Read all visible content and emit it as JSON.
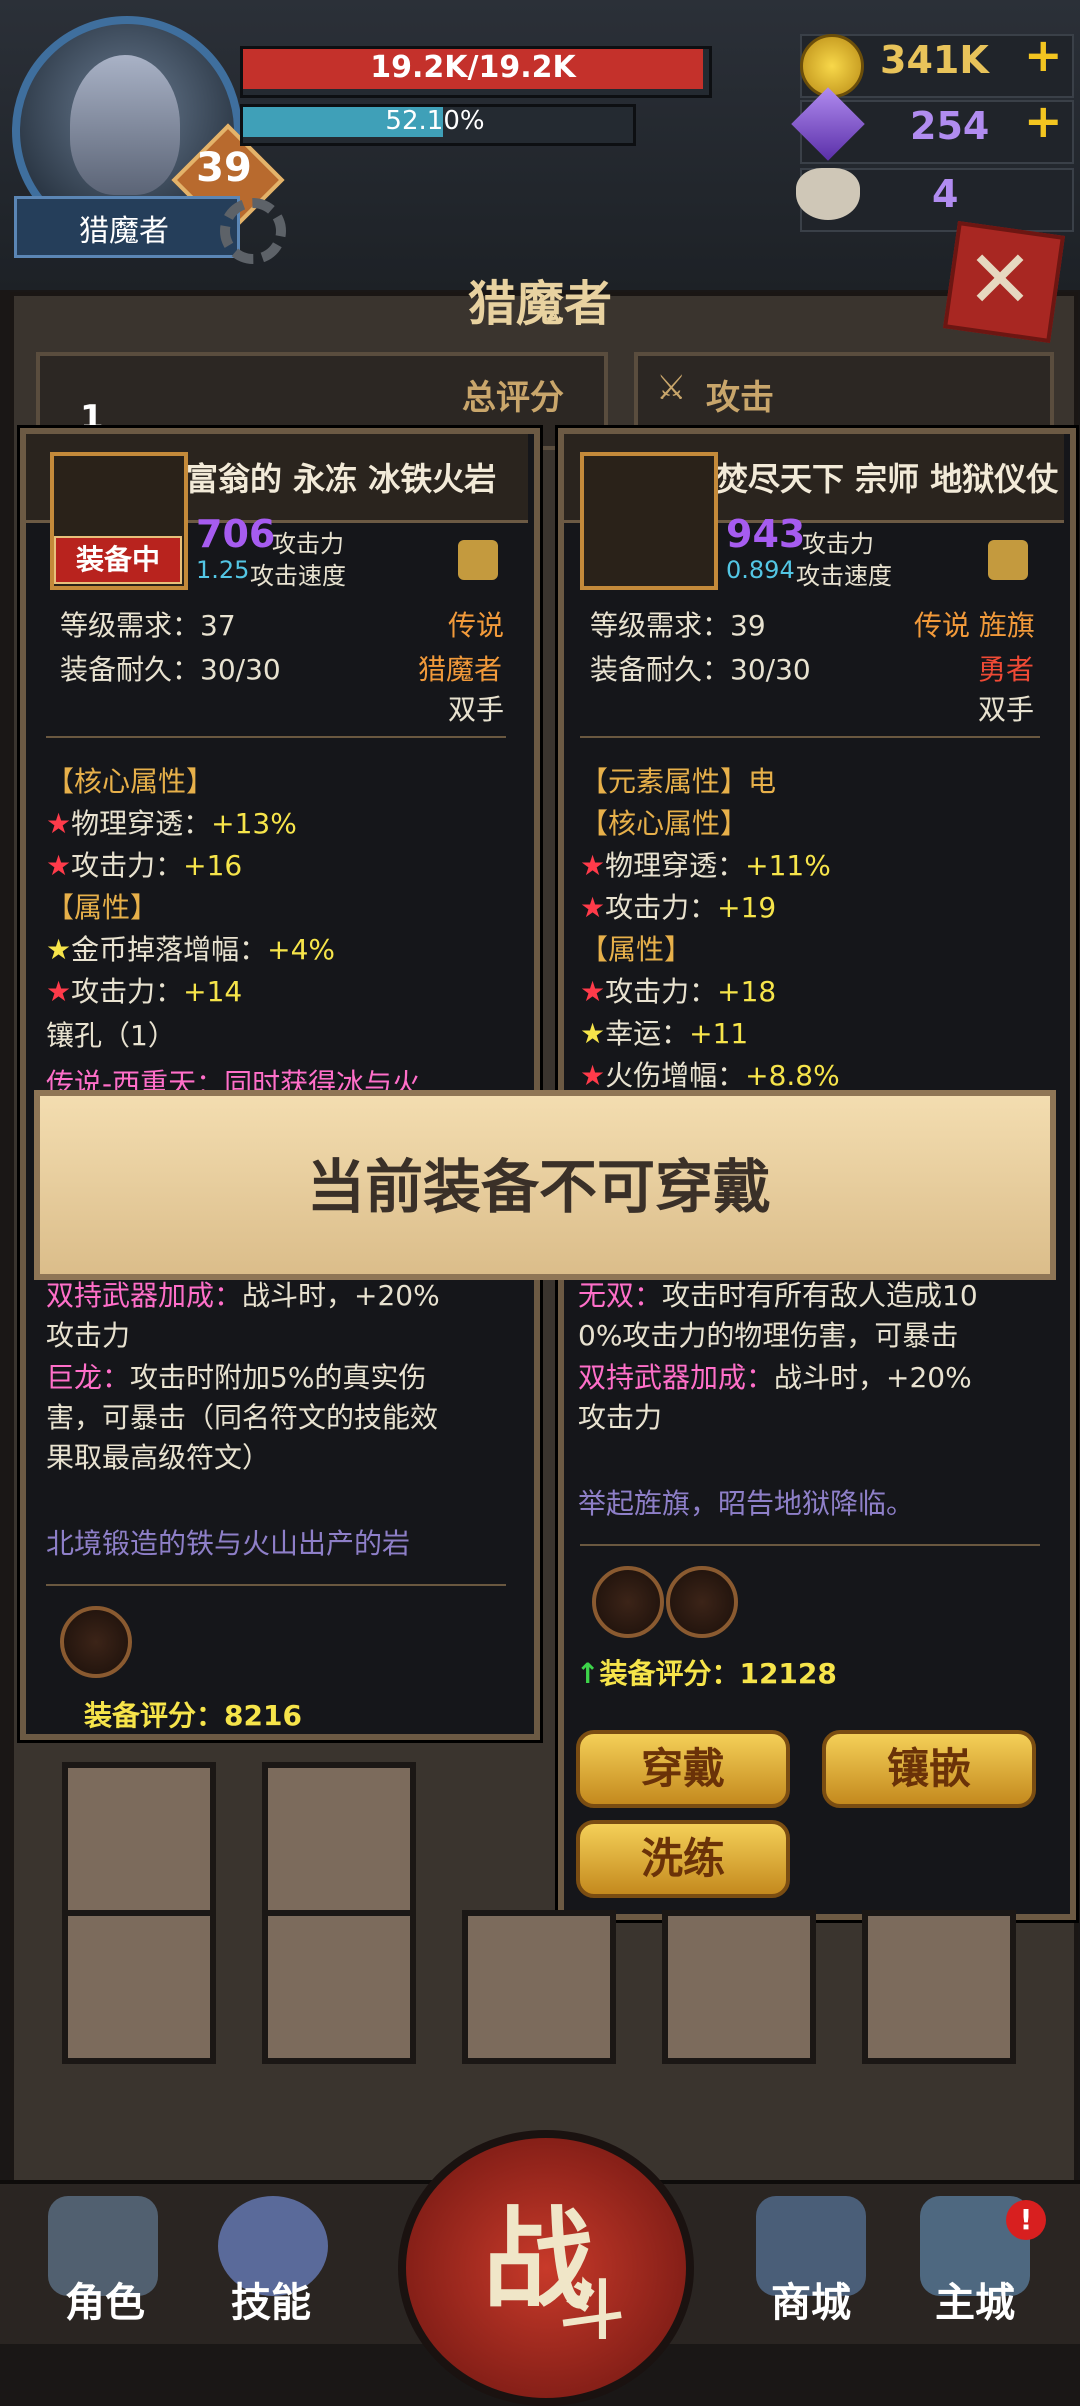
{
  "header": {
    "hp": "19.2K/19.2K",
    "hp_fraction": 1.0,
    "xp": "52.10%",
    "xp_fraction": 0.521,
    "level": "39",
    "class_name": "猎魔者",
    "gold": "341K",
    "gems": "254",
    "skulls": "4",
    "plus": "+"
  },
  "panel": {
    "title": "猎魔者",
    "bg_score_label": "总评分",
    "bg_attack_label": "攻击",
    "bg_slot_num": "1"
  },
  "left_card": {
    "name": "富翁的 永冻 冰铁火岩",
    "equipped": "装备中",
    "atk": "706",
    "atk_label": "攻击力",
    "spd": "1.25",
    "spd_label": "攻击速度",
    "req_level": "等级需求：37",
    "durability": "装备耐久：30/30",
    "rarity": "传说",
    "class": "猎魔者",
    "hand": "双手",
    "core_header": "【核心属性】",
    "core1_label": "物理穿透：",
    "core1_val": "+13%",
    "core2_label": "攻击力：",
    "core2_val": "+16",
    "attr_header": "【属性】",
    "attr1_label": "金币掉落增幅：",
    "attr1_val": "+4%",
    "attr2_label": "攻击力：",
    "attr2_val": "+14",
    "socket": "镶孔（1）",
    "legend_line": "传说-西重天：同时获得冰与火",
    "dual_label": "双持武器加成：",
    "dual_text": "战斗时，+20%",
    "dual_text2": "攻击力",
    "dragon_label": "巨龙：",
    "dragon_text": "攻击时附加5%的真实伤",
    "dragon_text2": "害，可暴击（同名符文的技能效",
    "dragon_text3": "果取最高级符文）",
    "flavor": "北境锻造的铁与火山出产的岩",
    "score": "装备评分：8216"
  },
  "right_card": {
    "name": "焚尽天下 宗师 地狱仪仗",
    "atk": "943",
    "atk_label": "攻击力",
    "spd": "0.894",
    "spd_label": "攻击速度",
    "req_level": "等级需求：39",
    "durability": "装备耐久：30/30",
    "rarity": "传说 旌旗",
    "class": "勇者",
    "hand": "双手",
    "elem_header": "【元素属性】电",
    "core_header": "【核心属性】",
    "core1_label": "物理穿透：",
    "core1_val": "+11%",
    "core2_label": "攻击力：",
    "core2_val": "+19",
    "attr_header": "【属性】",
    "attr1_label": "攻击力：",
    "attr1_val": "+18",
    "attr2_label": "幸运：",
    "attr2_val": "+11",
    "attr3_label": "火伤增幅：",
    "attr3_val": "+8.8%",
    "wushuang_label": "无双：",
    "wushuang_text": "攻击时有所有敌人造成10",
    "wushuang_text2": "0%攻击力的物理伤害，可暴击",
    "dual_label": "双持武器加成：",
    "dual_text": "战斗时，+20%",
    "dual_text2": "攻击力",
    "flavor": "举起旌旗，昭告地狱降临。",
    "score": "装备评分：12128",
    "btn_wear": "穿戴",
    "btn_inlay": "镶嵌",
    "btn_reforge": "洗练"
  },
  "banner": {
    "text": "当前装备不可穿戴"
  },
  "nav": {
    "role": "角色",
    "skill": "技能",
    "battle_big": "战",
    "battle_small": "斗",
    "shop": "商城",
    "city": "主城",
    "notify": "!"
  },
  "colors": {
    "hp": "#c4312b",
    "xp": "#3fa0b8",
    "accent": "#f3c520"
  }
}
